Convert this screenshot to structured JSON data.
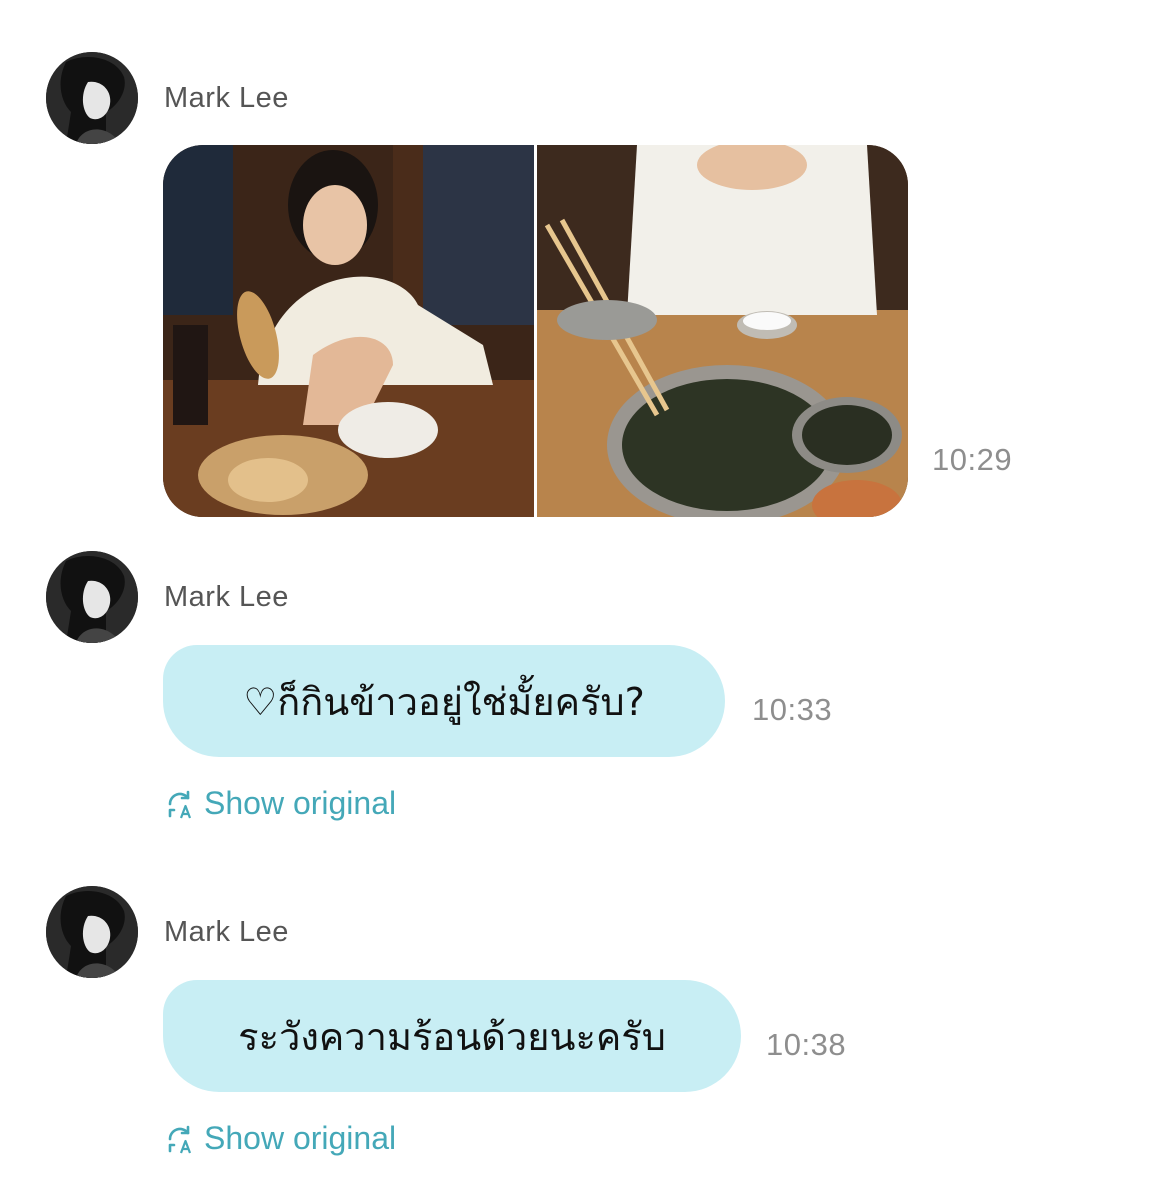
{
  "messages": [
    {
      "sender": "Mark Lee",
      "type": "photos",
      "photos": [
        "photo-bread-restaurant",
        "photo-seaweed-soup"
      ],
      "time": "10:29"
    },
    {
      "sender": "Mark Lee",
      "type": "text",
      "text": "♡ก็กินข้าวอยู่ใช่มั้ยครับ?",
      "time": "10:33",
      "show_original": "Show original"
    },
    {
      "sender": "Mark Lee",
      "type": "text",
      "text": "ระวังความร้อนด้วยนะครับ",
      "time": "10:38",
      "show_original": "Show original"
    }
  ],
  "colors": {
    "bubble": "#c8eef4",
    "link": "#44a8b8",
    "timestamp": "#8e8e8e",
    "sender": "#555555"
  },
  "icons": [
    "avatar-photo",
    "translate-icon"
  ]
}
